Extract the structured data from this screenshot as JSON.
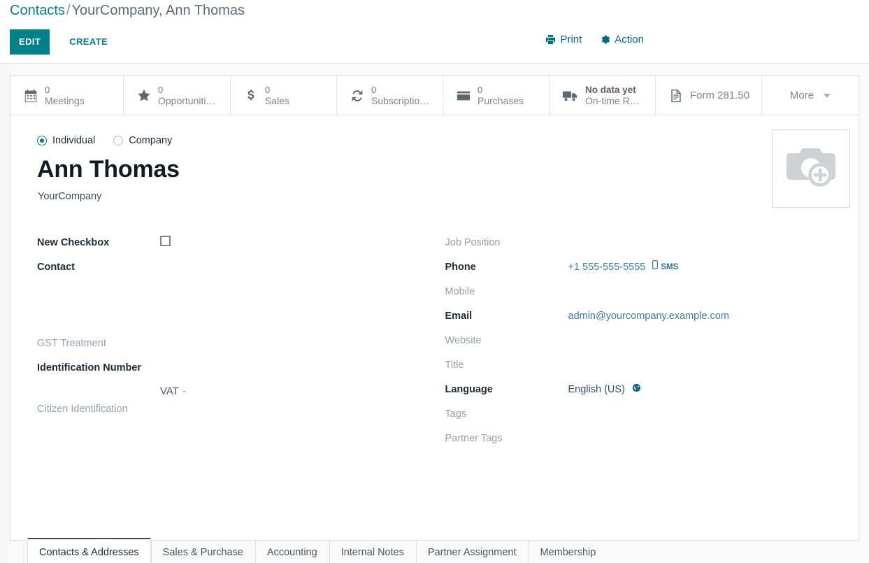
{
  "breadcrumb": {
    "root": "Contacts",
    "separator": "/",
    "current": "YourCompany, Ann Thomas"
  },
  "toolbar": {
    "edit_label": "EDIT",
    "create_label": "CREATE",
    "print_label": "Print",
    "action_label": "Action",
    "print_icon": "printer-icon",
    "action_icon": "gear-icon",
    "accent_color": "#00818a"
  },
  "stat_buttons": [
    {
      "icon": "calendar-icon",
      "value": "0",
      "label": "Meetings"
    },
    {
      "icon": "star-icon",
      "value": "0",
      "label": "Opportuniti…"
    },
    {
      "icon": "dollar-icon",
      "value": "0",
      "label": "Sales"
    },
    {
      "icon": "refresh-icon",
      "value": "0",
      "label": "Subscriptio…"
    },
    {
      "icon": "credit-card-icon",
      "value": "0",
      "label": "Purchases"
    },
    {
      "icon": "truck-icon",
      "value": "No data yet",
      "label": "On-time Ra…"
    },
    {
      "icon": "file-text-icon",
      "value": "",
      "label": "Form 281.50"
    }
  ],
  "more_button": {
    "label": "More",
    "icon": "chevron-down-icon"
  },
  "record": {
    "type_options": [
      {
        "label": "Individual",
        "selected": true
      },
      {
        "label": "Company",
        "selected": false
      }
    ],
    "name": "Ann Thomas",
    "parent_company": "YourCompany",
    "avatar_icon": "camera-add-icon"
  },
  "left_fields": [
    {
      "label": "New Checkbox",
      "bold": true,
      "widget": "checkbox",
      "value": ""
    },
    {
      "label": "Contact",
      "bold": true,
      "widget": "text",
      "value": ""
    },
    {
      "label": "GST Treatment",
      "bold": false,
      "widget": "text",
      "value": ""
    },
    {
      "label": "Identification Number",
      "bold": true,
      "widget": "text",
      "value": ""
    },
    {
      "label": "Citizen Identification",
      "bold": false,
      "widget": "text",
      "value": ""
    }
  ],
  "vat": {
    "key": "VAT",
    "value": "-"
  },
  "right_fields": [
    {
      "label": "Job Position",
      "bold": false,
      "value": "",
      "style": ""
    },
    {
      "label": "Phone",
      "bold": true,
      "value": "+1 555-555-5555",
      "style": "link",
      "extra": "SMS",
      "extra_icon": "mobile-icon"
    },
    {
      "label": "Mobile",
      "bold": false,
      "value": "",
      "style": ""
    },
    {
      "label": "Email",
      "bold": true,
      "value": "admin@yourcompany.example.com",
      "style": "link"
    },
    {
      "label": "Website",
      "bold": false,
      "value": "",
      "style": ""
    },
    {
      "label": "Title",
      "bold": false,
      "value": "",
      "style": ""
    },
    {
      "label": "Language",
      "bold": true,
      "value": "English (US)",
      "style": "plain",
      "extra_icon": "globe-icon"
    },
    {
      "label": "Tags",
      "bold": false,
      "value": "",
      "style": ""
    },
    {
      "label": "Partner Tags",
      "bold": false,
      "value": "",
      "style": ""
    }
  ],
  "tabs": [
    {
      "label": "Contacts & Addresses",
      "active": true
    },
    {
      "label": "Sales & Purchase",
      "active": false
    },
    {
      "label": "Accounting",
      "active": false
    },
    {
      "label": "Internal Notes",
      "active": false
    },
    {
      "label": "Partner Assignment",
      "active": false
    },
    {
      "label": "Membership",
      "active": false
    }
  ]
}
